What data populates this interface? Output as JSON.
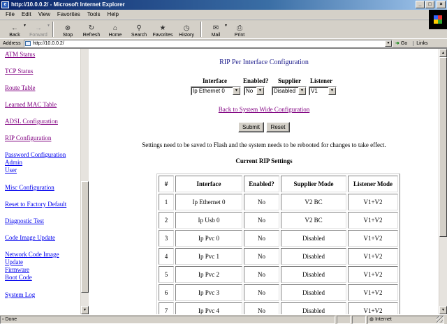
{
  "window": {
    "title": "http://10.0.0.2/ - Microsoft Internet Explorer",
    "buttons": {
      "min": "_",
      "max": "□",
      "close": "×"
    }
  },
  "menu": [
    "File",
    "Edit",
    "View",
    "Favorites",
    "Tools",
    "Help"
  ],
  "toolbar": [
    {
      "label": "Back",
      "icon": "←",
      "enabled": true,
      "dropdown": true
    },
    {
      "label": "Forward",
      "icon": "→",
      "enabled": false,
      "dropdown": true
    },
    {
      "label": "Stop",
      "icon": "⊗",
      "enabled": true
    },
    {
      "label": "Refresh",
      "icon": "↻",
      "enabled": true
    },
    {
      "label": "Home",
      "icon": "⌂",
      "enabled": true
    },
    {
      "label": "Search",
      "icon": "⚲",
      "enabled": true
    },
    {
      "label": "Favorites",
      "icon": "★",
      "enabled": true
    },
    {
      "label": "History",
      "icon": "◷",
      "enabled": true
    },
    {
      "label": "Mail",
      "icon": "✉",
      "enabled": true,
      "dropdown": true
    },
    {
      "label": "Print",
      "icon": "⎙",
      "enabled": true
    }
  ],
  "address": {
    "label": "Address",
    "url": "http://10.0.0.2/",
    "go": "Go",
    "links": "Links"
  },
  "sidebar": {
    "links": [
      {
        "label": "ATM Status",
        "visited": true
      },
      {
        "label": "TCP Status",
        "visited": true
      },
      {
        "label": "Route Table",
        "visited": true
      },
      {
        "label": "Learned MAC Table",
        "visited": true
      },
      {
        "label": "ADSL Configuration",
        "visited": true
      },
      {
        "label": "RIP Configuration",
        "visited": true
      },
      {
        "label": "Password Configuration",
        "visited": false
      },
      {
        "label": "Admin",
        "visited": false
      },
      {
        "label": "User",
        "visited": false
      },
      {
        "label": "Misc Configuration",
        "visited": false
      },
      {
        "label": "Reset to Factory Default",
        "visited": false
      },
      {
        "label": "Diagnostic Test",
        "visited": false
      },
      {
        "label": "Code Image Update",
        "visited": false
      },
      {
        "label": "Network Code Image",
        "visited": false
      },
      {
        "label": "Update",
        "visited": false
      },
      {
        "label": "Firmware",
        "visited": false
      },
      {
        "label": "Boot Code",
        "visited": false
      },
      {
        "label": "System Log",
        "visited": false
      }
    ]
  },
  "main": {
    "title": "RIP Per Interface Configuration",
    "headers": {
      "interface": "Interface",
      "enabled": "Enabled?",
      "supplier": "Supplier",
      "listener": "Listener"
    },
    "selects": {
      "interface": "Ip Ethernet 0",
      "enabled": "No",
      "supplier": "Disabled",
      "listener": "V1"
    },
    "back_link": "Back to System Wide Configuration",
    "submit": "Submit",
    "reset": "Reset",
    "note": "Settings need to be saved to Flash and the system needs to be rebooted for changes to take effect.",
    "current_title": "Current RIP Settings",
    "table": {
      "columns": [
        "#",
        "Interface",
        "Enabled?",
        "Supplier Mode",
        "Listener Mode"
      ],
      "rows": [
        [
          "1",
          "Ip Ethernet 0",
          "No",
          "V2 BC",
          "V1+V2"
        ],
        [
          "2",
          "Ip Usb 0",
          "No",
          "V2 BC",
          "V1+V2"
        ],
        [
          "3",
          "Ip Pvc 0",
          "No",
          "Disabled",
          "V1+V2"
        ],
        [
          "4",
          "Ip Pvc 1",
          "No",
          "Disabled",
          "V1+V2"
        ],
        [
          "5",
          "Ip Pvc 2",
          "No",
          "Disabled",
          "V1+V2"
        ],
        [
          "6",
          "Ip Pvc 3",
          "No",
          "Disabled",
          "V1+V2"
        ],
        [
          "7",
          "Ip Pvc 4",
          "No",
          "Disabled",
          "V1+V2"
        ]
      ]
    }
  },
  "status": {
    "text": "Done",
    "zone": "Internet"
  }
}
